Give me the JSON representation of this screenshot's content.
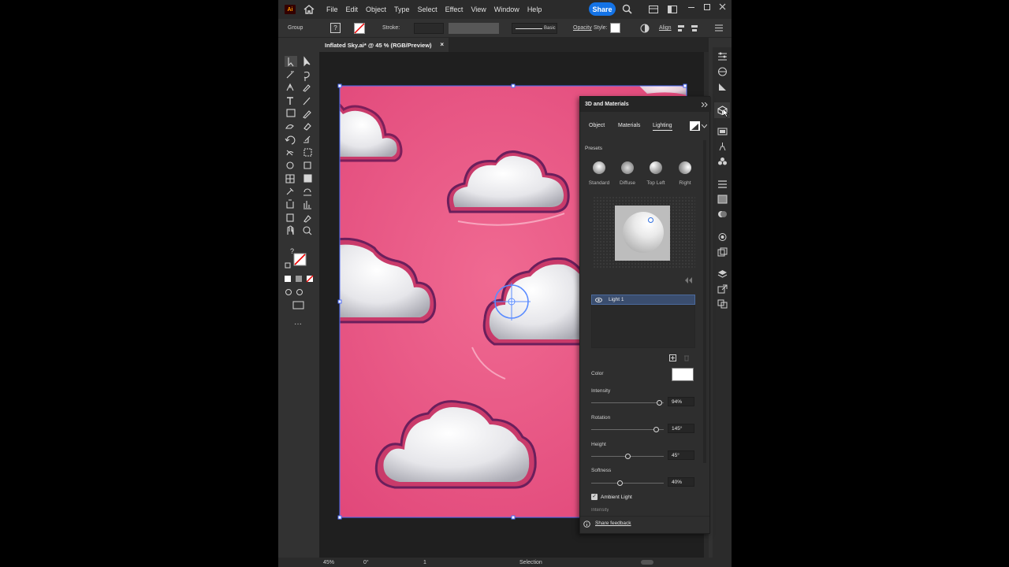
{
  "app": {
    "logo": "Ai",
    "menus": [
      "File",
      "Edit",
      "Object",
      "Type",
      "Select",
      "Effect",
      "View",
      "Window",
      "Help"
    ],
    "share_label": "Share"
  },
  "control_bar": {
    "selection_type": "Group",
    "stroke_label": "Stroke:",
    "brush_label": "Basic",
    "opacity_label": "Opacity",
    "style_label": "Style:",
    "align_label": "Align"
  },
  "document": {
    "tab_title": "Inflated Sky.ai* @ 45 % (RGB/Preview)",
    "close_glyph": "×"
  },
  "panel": {
    "title": "3D and Materials",
    "tabs": [
      "Object",
      "Materials",
      "Lighting"
    ],
    "active_tab": "Lighting",
    "presets_label": "Presets",
    "presets": [
      "Standard",
      "Diffuse",
      "Top Left",
      "Right"
    ],
    "light_name": "Light 1",
    "color_label": "Color",
    "intensity": {
      "label": "Intensity",
      "value": "94%",
      "fraction": 0.94
    },
    "rotation": {
      "label": "Rotation",
      "value": "145°",
      "fraction": 0.9
    },
    "height": {
      "label": "Height",
      "value": "45°",
      "fraction": 0.5
    },
    "softness": {
      "label": "Softness",
      "value": "40%",
      "fraction": 0.4
    },
    "ambient_label": "Ambient Light",
    "ambient_checked": true,
    "cut_label": "Intensity",
    "feedback_label": "Share feedback"
  },
  "status": {
    "zoom": "45%",
    "rotation": "0°",
    "artboard": "1",
    "tool": "Selection"
  },
  "colors": {
    "artboard": "#e9557f",
    "accent": "#1473e6"
  }
}
